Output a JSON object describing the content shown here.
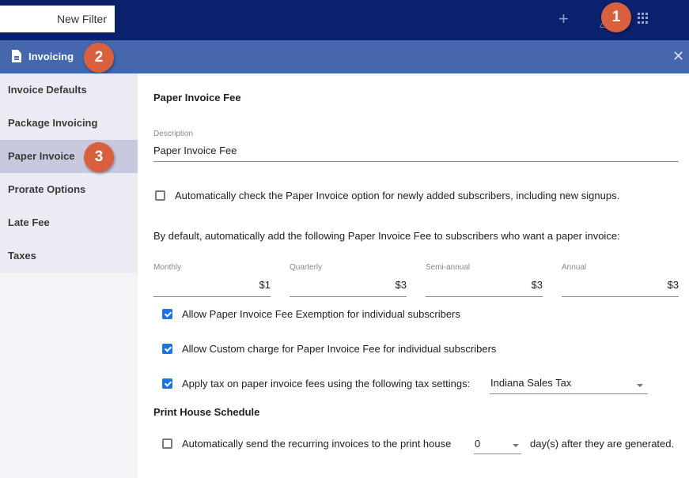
{
  "topbar": {
    "filter_label": "New Filter",
    "icons": [
      "plus-icon",
      "bell-icon",
      "apps-grid-icon"
    ],
    "badge_1": "1"
  },
  "subbar": {
    "title": "Invoicing",
    "icon": "document-icon",
    "badge_2": "2",
    "close_icon": "close-icon"
  },
  "sidebar": {
    "items": [
      {
        "label": "Invoice Defaults",
        "active": false
      },
      {
        "label": "Package Invoicing",
        "active": false
      },
      {
        "label": "Paper Invoice",
        "active": true
      },
      {
        "label": "Prorate Options",
        "active": false
      },
      {
        "label": "Late Fee",
        "active": false
      },
      {
        "label": "Taxes",
        "active": false
      }
    ],
    "badge_3": "3"
  },
  "main": {
    "section_title": "Paper Invoice Fee",
    "description": {
      "label": "Description",
      "value": "Paper Invoice Fee"
    },
    "auto_check": {
      "checked": false,
      "label": "Automatically check the Paper Invoice option for newly added subscribers, including new signups."
    },
    "default_text": "By default, automatically add the following Paper Invoice Fee to subscribers who want a paper invoice:",
    "fees": [
      {
        "label": "Monthly",
        "value": "$1"
      },
      {
        "label": "Quarterly",
        "value": "$3"
      },
      {
        "label": "Semi-annual",
        "value": "$3"
      },
      {
        "label": "Annual",
        "value": "$3"
      }
    ],
    "allow_exemption": {
      "checked": true,
      "label": "Allow Paper Invoice Fee Exemption for individual subscribers"
    },
    "allow_custom": {
      "checked": true,
      "label": "Allow Custom charge for Paper Invoice Fee for individual subscribers"
    },
    "apply_tax": {
      "checked": true,
      "label": "Apply tax on paper invoice fees using the following tax settings:",
      "selected": "Indiana Sales Tax"
    },
    "print_house_title": "Print House Schedule",
    "print_house": {
      "checked": false,
      "label": "Automatically send the recurring invoices to the print house",
      "days_selected": "0",
      "suffix": "day(s) after they are generated."
    }
  }
}
